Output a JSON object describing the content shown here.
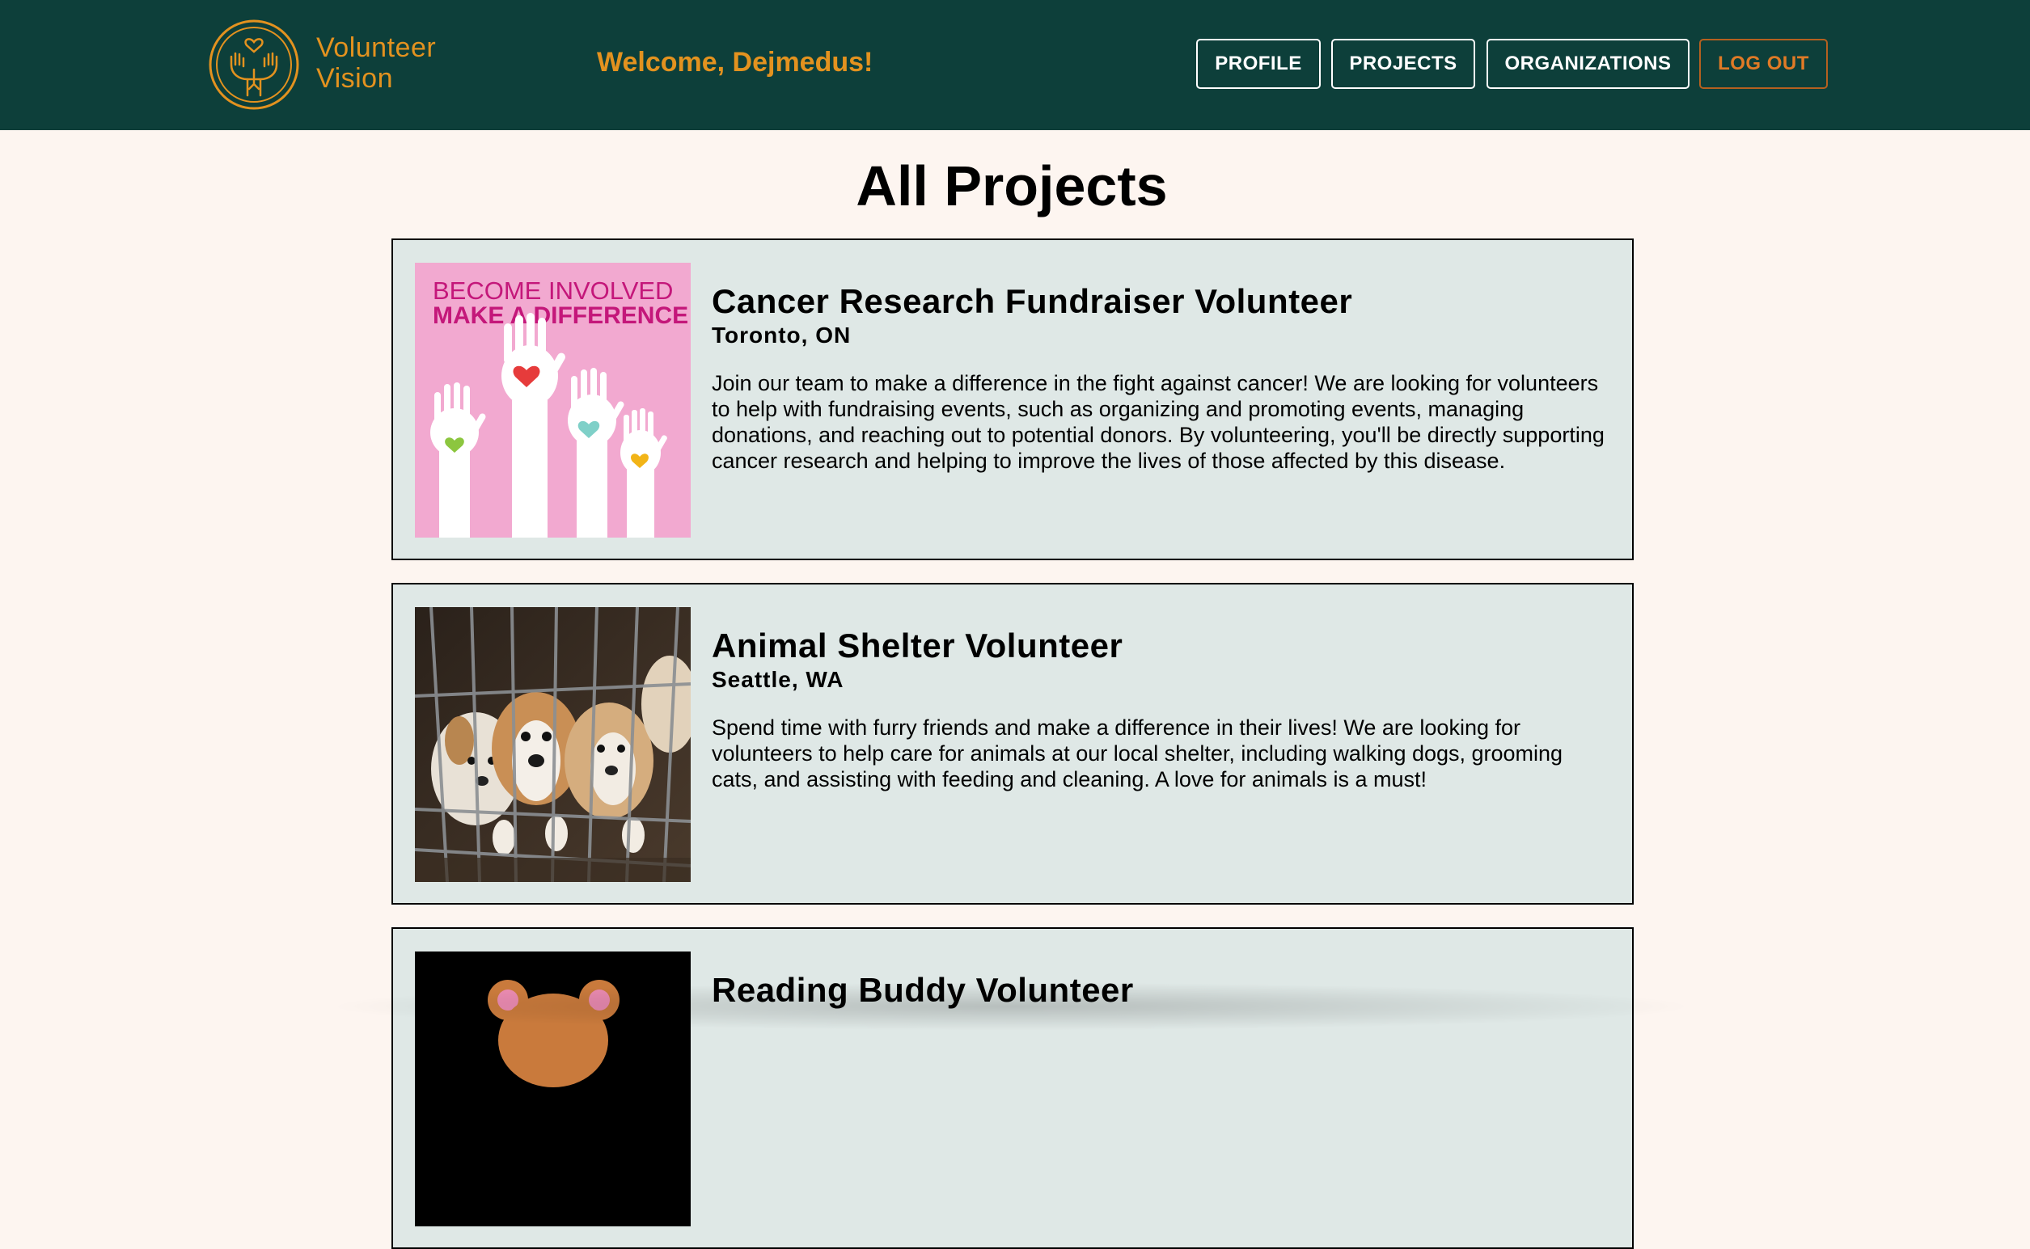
{
  "header": {
    "logo_line1": "Volunteer",
    "logo_line2": "Vision",
    "welcome": "Welcome, Dejmedus!",
    "nav": {
      "profile": "PROFILE",
      "projects": "PROJECTS",
      "organizations": "ORGANIZATIONS",
      "logout": "LOG OUT"
    },
    "colors": {
      "bg": "#0d3f3a",
      "accent": "#e3921f",
      "logout": "#e07a26"
    }
  },
  "main": {
    "title": "All Projects",
    "projects": [
      {
        "title": "Cancer Research Fundraiser Volunteer",
        "location": "Toronto, ON",
        "description": "Join our team to make a difference in the fight against cancer! We are looking for volunteers to help with fundraising events, such as organizing and promoting events, managing donations, and reaching out to potential donors. By volunteering, you'll be directly supporting cancer research and helping to improve the lives of those affected by this disease.",
        "image": {
          "line1": "BECOME INVOLVED",
          "line2": "MAKE A DIFFERENCE"
        }
      },
      {
        "title": "Animal Shelter Volunteer",
        "location": "Seattle, WA",
        "description": "Spend time with furry friends and make a difference in their lives! We are looking for volunteers to help care for animals at our local shelter, including walking dogs, grooming cats, and assisting with feeding and cleaning. A love for animals is a must!"
      },
      {
        "title": "Reading Buddy Volunteer"
      }
    ]
  }
}
